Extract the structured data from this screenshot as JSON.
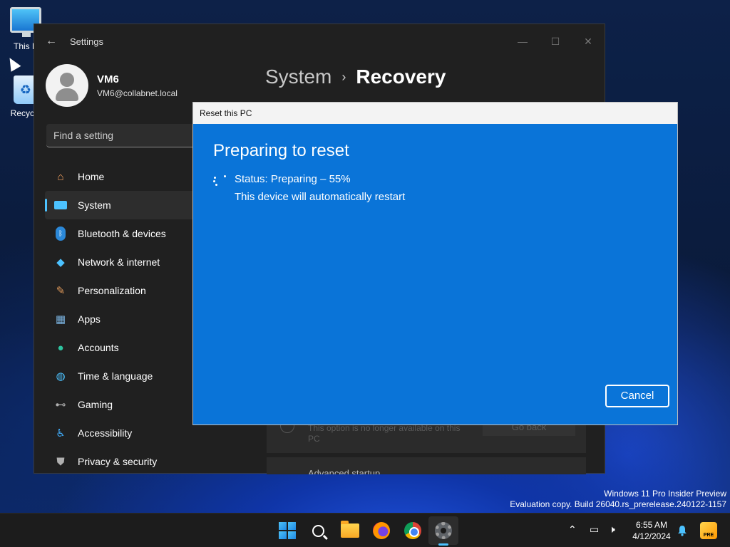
{
  "desktop": {
    "icons": [
      {
        "label": "This P"
      },
      {
        "label": "Recycle"
      }
    ]
  },
  "settings": {
    "title": "Settings",
    "user": {
      "name": "VM6",
      "email": "VM6@collabnet.local"
    },
    "search_placeholder": "Find a setting",
    "nav": [
      {
        "label": "Home",
        "icon": "home-icon",
        "color": "#f4a261"
      },
      {
        "label": "System",
        "icon": "system-icon",
        "color": "#4cc2ff",
        "active": true
      },
      {
        "label": "Bluetooth & devices",
        "icon": "bluetooth-icon",
        "color": "#2b88d8"
      },
      {
        "label": "Network & internet",
        "icon": "wifi-icon",
        "color": "#4cc2ff"
      },
      {
        "label": "Personalization",
        "icon": "brush-icon",
        "color": "#e09a5a"
      },
      {
        "label": "Apps",
        "icon": "apps-icon",
        "color": "#7ab3e0"
      },
      {
        "label": "Accounts",
        "icon": "accounts-icon",
        "color": "#2ec4a0"
      },
      {
        "label": "Time & language",
        "icon": "globe-icon",
        "color": "#4cc2ff"
      },
      {
        "label": "Gaming",
        "icon": "gamepad-icon",
        "color": "#b0b0b0"
      },
      {
        "label": "Accessibility",
        "icon": "accessibility-icon",
        "color": "#3fa9f5"
      },
      {
        "label": "Privacy & security",
        "icon": "shield-icon",
        "color": "#b0b0b0"
      }
    ],
    "breadcrumb": {
      "parent": "System",
      "current": "Recovery"
    },
    "background_option": {
      "text": "This option is no longer available on this PC",
      "button": "Go back"
    },
    "advanced_startup": "Advanced startup"
  },
  "reset_dialog": {
    "title": "Reset this PC",
    "heading": "Preparing to reset",
    "status": "Status: Preparing – 55%",
    "progress_percent": 55,
    "note": "This device will automatically restart",
    "cancel_label": "Cancel",
    "accent_color": "#0a74d8"
  },
  "watermark": {
    "line1": "Windows 11 Pro Insider Preview",
    "line2": "Evaluation copy. Build 26040.rs_prerelease.240122-1157"
  },
  "taskbar": {
    "apps": [
      "start-icon",
      "search-icon",
      "file-explorer-icon",
      "firefox-icon",
      "chrome-icon",
      "settings-icon"
    ],
    "active_app": "settings-icon",
    "time": "6:55 AM",
    "date": "4/12/2024",
    "badge": "PRE"
  }
}
